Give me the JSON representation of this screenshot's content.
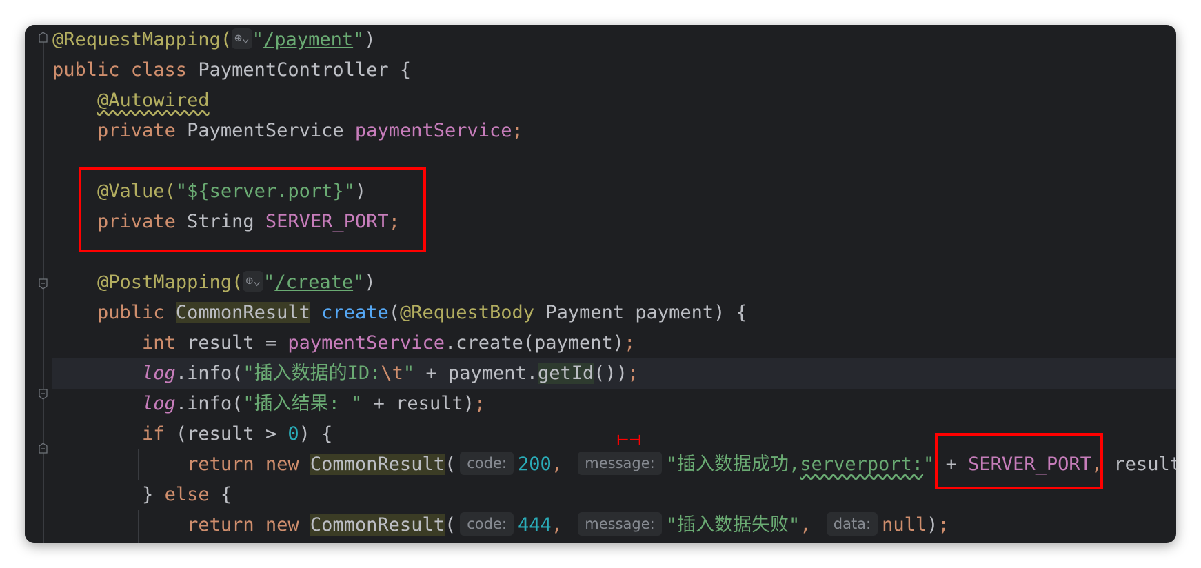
{
  "editor": {
    "lines": [
      {
        "parts": [
          [
            "ann",
            "@RequestMapping("
          ],
          [
            "globe",
            "⊕⌄"
          ],
          [
            "str",
            "\""
          ],
          [
            "link",
            "/payment"
          ],
          [
            "str",
            "\""
          ],
          [
            "call",
            ")"
          ]
        ]
      },
      {
        "parts": [
          [
            "kw",
            "public class "
          ],
          [
            "call",
            "PaymentController {"
          ]
        ]
      },
      {
        "parts": [
          [
            "call",
            "    "
          ],
          [
            "ann wavy",
            "@Autowired"
          ]
        ]
      },
      {
        "parts": [
          [
            "call",
            "    "
          ],
          [
            "kw",
            "private "
          ],
          [
            "call",
            "PaymentService "
          ],
          [
            "fld",
            "paymentService"
          ],
          [
            "kw",
            ";"
          ]
        ]
      },
      {
        "parts": [
          [
            "call",
            ""
          ]
        ]
      },
      {
        "parts": [
          [
            "call",
            "    "
          ],
          [
            "ann",
            "@Value("
          ],
          [
            "str",
            "\"${server.port}\""
          ],
          [
            "call",
            ")"
          ]
        ]
      },
      {
        "parts": [
          [
            "call",
            "    "
          ],
          [
            "kw",
            "private "
          ],
          [
            "call",
            "String "
          ],
          [
            "fld",
            "SERVER_PORT"
          ],
          [
            "kw",
            ";"
          ]
        ]
      },
      {
        "parts": [
          [
            "call",
            ""
          ]
        ]
      },
      {
        "parts": [
          [
            "call",
            "    "
          ],
          [
            "ann",
            "@PostMapping("
          ],
          [
            "globe",
            "⊕⌄"
          ],
          [
            "str",
            "\""
          ],
          [
            "link",
            "/create"
          ],
          [
            "str",
            "\""
          ],
          [
            "call",
            ")"
          ]
        ]
      },
      {
        "parts": [
          [
            "call",
            "    "
          ],
          [
            "kw",
            "public "
          ],
          [
            "call hl",
            "CommonResult"
          ],
          [
            "call",
            " "
          ],
          [
            "mname",
            "create"
          ],
          [
            "call",
            "("
          ],
          [
            "ann",
            "@RequestBody "
          ],
          [
            "call",
            "Payment payment) {"
          ]
        ]
      },
      {
        "parts": [
          [
            "call",
            "        "
          ],
          [
            "kw",
            "int "
          ],
          [
            "call",
            "result = "
          ],
          [
            "fld",
            "paymentService"
          ],
          [
            "call",
            ".create(payment)"
          ],
          [
            "kw",
            ";"
          ]
        ]
      },
      {
        "parts": [
          [
            "call",
            "        "
          ],
          [
            "log",
            "log"
          ],
          [
            "call",
            ".info("
          ],
          [
            "str",
            "\"插入数据的ID:"
          ],
          [
            "kw",
            "\\t"
          ],
          [
            "str",
            "\""
          ],
          [
            "call",
            " + payment."
          ],
          [
            "call hlg",
            "getId"
          ],
          [
            "call",
            "())"
          ],
          [
            "kw",
            ";"
          ]
        ],
        "active": true
      },
      {
        "parts": [
          [
            "call",
            "        "
          ],
          [
            "log",
            "log"
          ],
          [
            "call",
            ".info("
          ],
          [
            "str",
            "\"插入结果: \""
          ],
          [
            "call",
            " + result)"
          ],
          [
            "kw",
            ";"
          ]
        ]
      },
      {
        "parts": [
          [
            "call",
            "        "
          ],
          [
            "kw",
            "if "
          ],
          [
            "call",
            "(result > "
          ],
          [
            "num",
            "0"
          ],
          [
            "call",
            ") {"
          ]
        ]
      },
      {
        "parts": [
          [
            "call",
            "            "
          ],
          [
            "kw",
            "return new "
          ],
          [
            "call hl",
            "CommonResult"
          ],
          [
            "call",
            "("
          ],
          [
            "hint",
            "code:"
          ],
          [
            "num",
            "200"
          ],
          [
            "kw",
            ", "
          ],
          [
            "hint",
            "message:"
          ],
          [
            "str",
            "\"插入数据成功,"
          ],
          [
            "str wavy-s",
            "serverport:"
          ],
          [
            "str",
            "\""
          ],
          [
            "call",
            " + "
          ],
          [
            "fld",
            "SERVER_PORT"
          ],
          [
            "kw",
            ", "
          ],
          [
            "call",
            "result)"
          ]
        ]
      },
      {
        "parts": [
          [
            "call",
            "        } "
          ],
          [
            "kw",
            "else "
          ],
          [
            "call",
            "{"
          ]
        ]
      },
      {
        "parts": [
          [
            "call",
            "            "
          ],
          [
            "kw",
            "return new "
          ],
          [
            "call hl",
            "CommonResult"
          ],
          [
            "call",
            "("
          ],
          [
            "hint",
            "code:"
          ],
          [
            "num",
            "444"
          ],
          [
            "kw",
            ", "
          ],
          [
            "hint",
            "message:"
          ],
          [
            "str",
            "\"插入数据失败\""
          ],
          [
            "kw",
            ", "
          ],
          [
            "hint",
            "data:"
          ],
          [
            "kw",
            "null"
          ],
          [
            "call",
            ")"
          ],
          [
            "kw",
            ";"
          ]
        ]
      }
    ]
  },
  "annotations": {
    "redmark_text": "⊢⊣",
    "box_color": "#ff0000"
  },
  "colors": {
    "background": "#1e1f22",
    "keyword": "#cf8e6d",
    "annotation": "#b3ae60",
    "string": "#6aab73",
    "number": "#2aacb8",
    "field": "#c77dbb"
  }
}
